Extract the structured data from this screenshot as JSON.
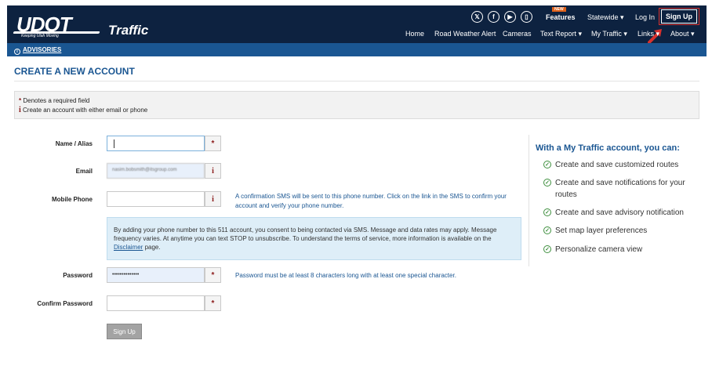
{
  "header": {
    "logo_text": "UDOT",
    "logo_tagline": "Keeping Utah Moving",
    "app_name": "Traffic",
    "social_icons": [
      "x-icon",
      "facebook-icon",
      "youtube-icon",
      "mobile-app-icon"
    ],
    "new_badge": "NEW",
    "features_label": "Features",
    "statewide_label": "Statewide",
    "login_label": "Log In",
    "signup_label": "Sign Up",
    "highlight_color": "#d9302c",
    "nav": {
      "home": "Home",
      "road_weather_alert": "Road Weather Alert",
      "cameras": "Cameras",
      "text_report": "Text Report",
      "my_traffic": "My Traffic",
      "links": "Links",
      "about": "About"
    }
  },
  "advisories": {
    "label": "ADVISORIES"
  },
  "page": {
    "title": "CREATE A NEW ACCOUNT",
    "note_required": "Denotes a required field",
    "note_contact": "Create an account with either email or phone"
  },
  "form": {
    "name": {
      "label": "Name / Alias",
      "value": ""
    },
    "email": {
      "label": "Email",
      "value": "nasim.bobsmith@itsgroup.com"
    },
    "phone": {
      "label": "Mobile Phone",
      "value": "",
      "hint": "A confirmation SMS will be sent to this phone number. Click on the link in the SMS to confirm your account and verify your phone number."
    },
    "consent": {
      "text_before": "By adding your phone number to this 511 account, you consent to being contacted via SMS. Message and data rates may apply. Message frequency varies. At anytime you can text STOP to unsubscribe. To understand the terms of service, more information is available on the ",
      "link": "Disclaimer",
      "text_after": " page."
    },
    "password": {
      "label": "Password",
      "value": "••••••••••••••",
      "hint": "Password must be at least 8 characters long with at least one special character."
    },
    "confirm_password": {
      "label": "Confirm Password",
      "value": ""
    },
    "submit_label": "Sign Up"
  },
  "benefits": {
    "title": "With a My Traffic account, you can:",
    "items": [
      "Create and save customized routes",
      "Create and save notifications for your routes",
      "Create and save advisory notification",
      "Set map layer preferences",
      "Personalize camera view"
    ]
  }
}
